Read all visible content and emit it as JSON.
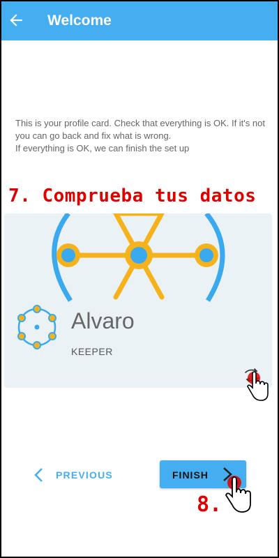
{
  "appbar": {
    "title": "Welcome",
    "back_icon": "arrow-left-icon",
    "color": "#45aef0"
  },
  "description": {
    "line1": "This is your profile card. Check that everything is OK. If it's not you can go back and fix what is wrong.",
    "line2": "If everything is OK, we can finish the set up"
  },
  "annotations": {
    "step7": "7. Comprueba tus datos",
    "step8": "8.",
    "color": "#e00000"
  },
  "card": {
    "name": "Alvaro",
    "role": "KEEPER",
    "flip_icon": "swap-arrows-icon",
    "background": "#ebf2f6",
    "accent_orange": "#f6b21a",
    "accent_blue": "#3aa9ee"
  },
  "footer": {
    "previous_label": "PREVIOUS",
    "finish_label": "FINISH",
    "previous_icon": "chevron-left-icon",
    "finish_icon": "chevron-right-icon"
  }
}
